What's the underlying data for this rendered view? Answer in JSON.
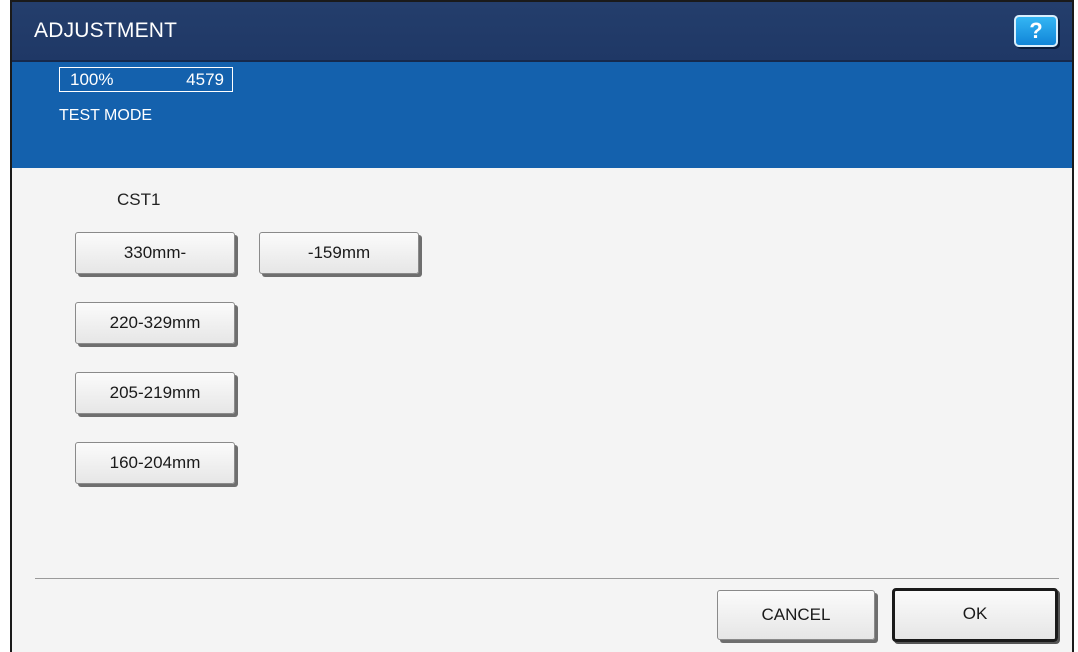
{
  "window": {
    "title": "ADJUSTMENT",
    "help_label": "?"
  },
  "status": {
    "zoom": "100%",
    "count": "4579",
    "mode": "TEST MODE"
  },
  "main": {
    "section_label": "CST1",
    "size_buttons": [
      {
        "label": "330mm-"
      },
      {
        "label": "-159mm"
      },
      {
        "label": "220-329mm"
      },
      {
        "label": "205-219mm"
      },
      {
        "label": "160-204mm"
      }
    ]
  },
  "footer": {
    "cancel_label": "CANCEL",
    "ok_label": "OK"
  },
  "colors": {
    "title_bar": "#243e6c",
    "status_panel": "#1461ad",
    "help_button": "#1e9be6",
    "background": "#f4f4f4"
  },
  "icons": {
    "help": "question-mark-icon"
  }
}
